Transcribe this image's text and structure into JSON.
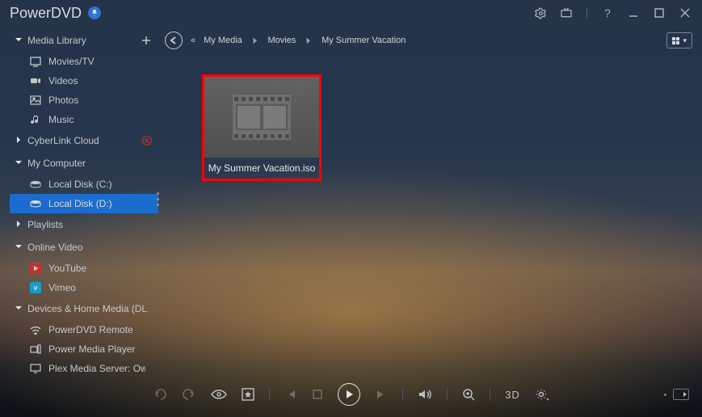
{
  "app": {
    "title": "PowerDVD"
  },
  "breadcrumb": [
    "My Media",
    "Movies",
    "My Summer Vacation"
  ],
  "sidebar": {
    "media_library": {
      "label": "Media Library",
      "items": [
        {
          "icon": "tv-icon",
          "label": "Movies/TV"
        },
        {
          "icon": "video-icon",
          "label": "Videos"
        },
        {
          "icon": "photo-icon",
          "label": "Photos"
        },
        {
          "icon": "music-icon",
          "label": "Music"
        }
      ]
    },
    "cyberlink_cloud": {
      "label": "CyberLink Cloud",
      "badge": "N"
    },
    "my_computer": {
      "label": "My Computer",
      "items": [
        {
          "label": "Local Disk (C:)",
          "selected": false
        },
        {
          "label": "Local Disk (D:)",
          "selected": true
        }
      ]
    },
    "playlists": {
      "label": "Playlists"
    },
    "online_video": {
      "label": "Online Video",
      "items": [
        {
          "label": "YouTube",
          "icon": "youtube"
        },
        {
          "label": "Vimeo",
          "icon": "vimeo"
        }
      ]
    },
    "devices": {
      "label": "Devices & Home Media (DL",
      "items": [
        {
          "label": "PowerDVD Remote"
        },
        {
          "label": "Power Media Player"
        },
        {
          "label": "Plex Media Server: Owe"
        }
      ]
    }
  },
  "files": [
    {
      "name": "My Summer Vacation.iso"
    }
  ],
  "playbar": {
    "label_3d": "3D"
  }
}
